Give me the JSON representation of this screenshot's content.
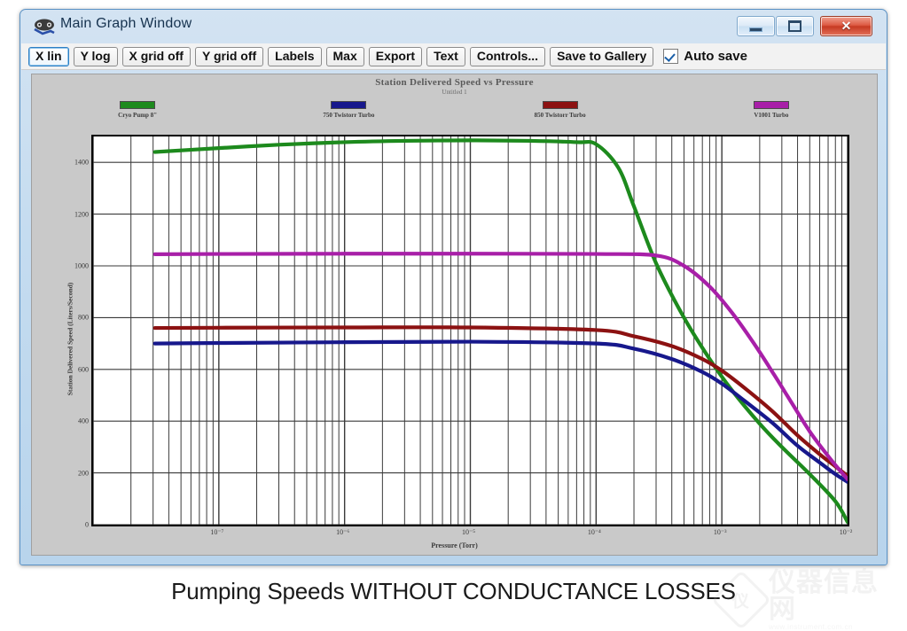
{
  "window": {
    "title": "Main Graph Window",
    "icon": "graph-window-icon",
    "buttons": {
      "minimize": "minimize-icon",
      "maximize": "maximize-icon",
      "close": "✕"
    }
  },
  "toolbar": {
    "buttons": [
      {
        "label": "X lin",
        "focused": true
      },
      {
        "label": "Y log",
        "focused": false
      },
      {
        "label": "X grid off",
        "focused": false
      },
      {
        "label": "Y grid off",
        "focused": false
      },
      {
        "label": "Labels",
        "focused": false
      },
      {
        "label": "Max",
        "focused": false
      },
      {
        "label": "Export",
        "focused": false
      },
      {
        "label": "Text",
        "focused": false
      },
      {
        "label": "Controls...",
        "focused": false
      },
      {
        "label": "Save to Gallery",
        "focused": false
      }
    ],
    "autosave": {
      "label": "Auto save",
      "checked": true
    }
  },
  "caption": "Pumping Speeds WITHOUT CONDUCTANCE LOSSES",
  "watermark": {
    "cn": "仪器信息网",
    "url": "www.instrument.com.cn",
    "badge": "仪"
  },
  "chart_data": {
    "type": "line",
    "title": "Station Delivered Speed vs Pressure",
    "subtitle": "Untitled 1",
    "xlabel": "Pressure (Torr)",
    "ylabel": "Station Delivered Speed (Liters/Second)",
    "xscale": "log",
    "yscale": "linear",
    "xlim": [
      1e-08,
      0.01
    ],
    "ylim": [
      0,
      1500
    ],
    "yticks": [
      0,
      200,
      400,
      600,
      800,
      1000,
      1200,
      1400
    ],
    "xticks": [
      "10⁻⁷",
      "10⁻⁶",
      "10⁻⁵",
      "10⁻⁴",
      "10⁻³",
      "10⁻²"
    ],
    "xtick_exponents": [
      -7,
      -6,
      -5,
      -4,
      -3,
      -2
    ],
    "grid": {
      "x": true,
      "y": true,
      "x_minor": true
    },
    "legend_position": "top",
    "series": [
      {
        "name": "Cryo Pump 8\"",
        "color": "#1d8a1d",
        "x": [
          3.1e-08,
          1e-07,
          3e-07,
          1e-06,
          3e-06,
          1e-05,
          3e-05,
          7e-05,
          0.0001,
          0.00015,
          0.0002,
          0.0003,
          0.0005,
          0.0008,
          0.0012,
          0.002,
          0.003,
          0.005,
          0.008,
          0.01
        ],
        "y": [
          1440,
          1455,
          1468,
          1478,
          1483,
          1485,
          1483,
          1478,
          1470,
          1380,
          1230,
          1010,
          800,
          640,
          520,
          390,
          300,
          195,
          90,
          10
        ]
      },
      {
        "name": "750 Twistorr Turbo",
        "color": "#17188c",
        "x": [
          3.1e-08,
          1e-07,
          1e-06,
          1e-05,
          0.0001,
          0.0002,
          0.0004,
          0.0007,
          0.001,
          0.0015,
          0.0025,
          0.004,
          0.006,
          0.008,
          0.01
        ],
        "y": [
          700,
          702,
          705,
          707,
          700,
          680,
          640,
          590,
          545,
          480,
          395,
          305,
          240,
          195,
          165
        ]
      },
      {
        "name": "850 Twistorr Turbo",
        "color": "#8c1212",
        "x": [
          3.1e-08,
          1e-07,
          1e-06,
          1e-05,
          0.0001,
          0.0002,
          0.0004,
          0.0007,
          0.001,
          0.0015,
          0.0025,
          0.004,
          0.006,
          0.008,
          0.01
        ],
        "y": [
          760,
          761,
          762,
          762,
          752,
          728,
          690,
          640,
          595,
          530,
          440,
          345,
          272,
          225,
          188
        ]
      },
      {
        "name": "V1001 Turbo",
        "color": "#a81fa8",
        "x": [
          3.1e-08,
          1e-07,
          1e-06,
          1e-05,
          0.0001,
          0.0003,
          0.0005,
          0.0008,
          0.0012,
          0.0018,
          0.0026,
          0.0036,
          0.005,
          0.007,
          0.0085,
          0.01
        ],
        "y": [
          1045,
          1046,
          1047,
          1047,
          1046,
          1040,
          1000,
          920,
          820,
          700,
          580,
          470,
          360,
          265,
          215,
          175
        ]
      }
    ]
  }
}
